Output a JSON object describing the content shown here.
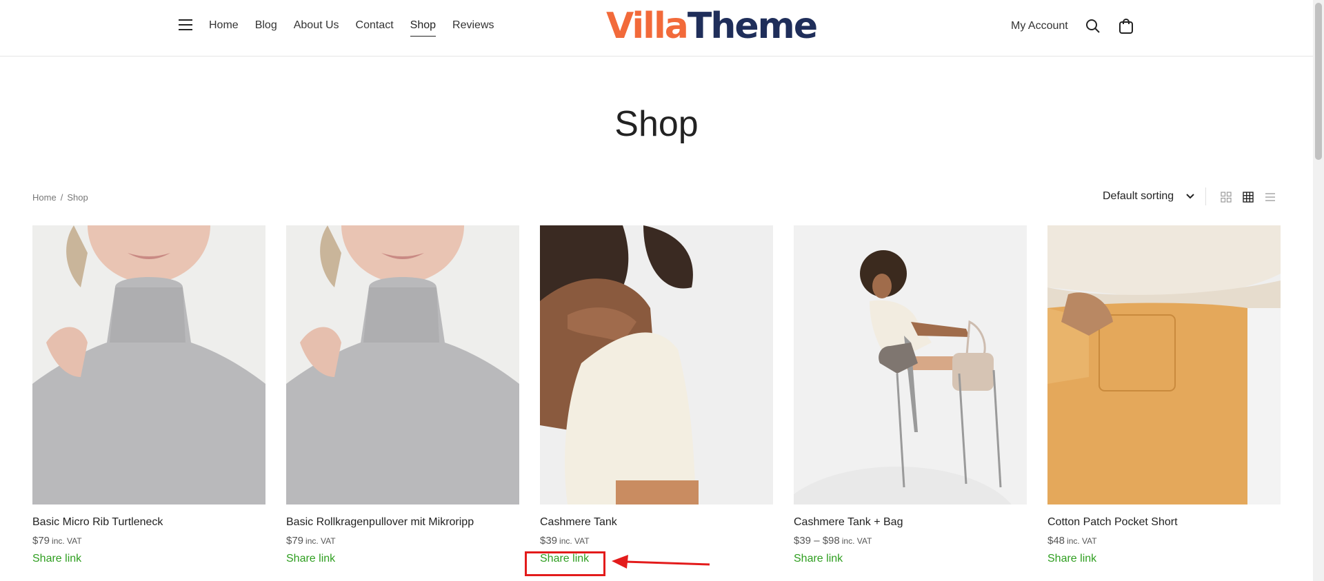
{
  "header": {
    "nav": [
      "Home",
      "Blog",
      "About Us",
      "Contact",
      "Shop",
      "Reviews"
    ],
    "active_nav": "Shop",
    "logo_part1": "Villa",
    "logo_part2": "Theme",
    "my_account": "My Account",
    "icons": [
      "hamburger-icon",
      "search-icon",
      "cart-icon"
    ]
  },
  "page_title": "Shop",
  "breadcrumb": {
    "home": "Home",
    "separator": "/",
    "current": "Shop"
  },
  "sorting": {
    "selected": "Default sorting"
  },
  "view_icons": [
    "grid-small-icon",
    "grid-icon",
    "list-icon"
  ],
  "products": [
    {
      "name": "Basic Micro Rib Turtleneck",
      "price": "$79",
      "vat": "inc. VAT",
      "share": "Share link"
    },
    {
      "name": "Basic Rollkragenpullover mit Mikroripp",
      "price": "$79",
      "vat": "inc. VAT",
      "share": "Share link"
    },
    {
      "name": "Cashmere Tank",
      "price": "$39",
      "vat": "inc. VAT",
      "share": "Share link"
    },
    {
      "name": "Cashmere Tank + Bag",
      "price": "$39 – $98",
      "vat": "inc. VAT",
      "share": "Share link"
    },
    {
      "name": "Cotton Patch Pocket Short",
      "price": "$48",
      "vat": "inc. VAT",
      "share": "Share link"
    }
  ],
  "colors": {
    "accent_green": "#2e9e1f",
    "logo_orange": "#f26a3a",
    "logo_navy": "#1f2e5a",
    "annotation_red": "#e31b1b"
  }
}
